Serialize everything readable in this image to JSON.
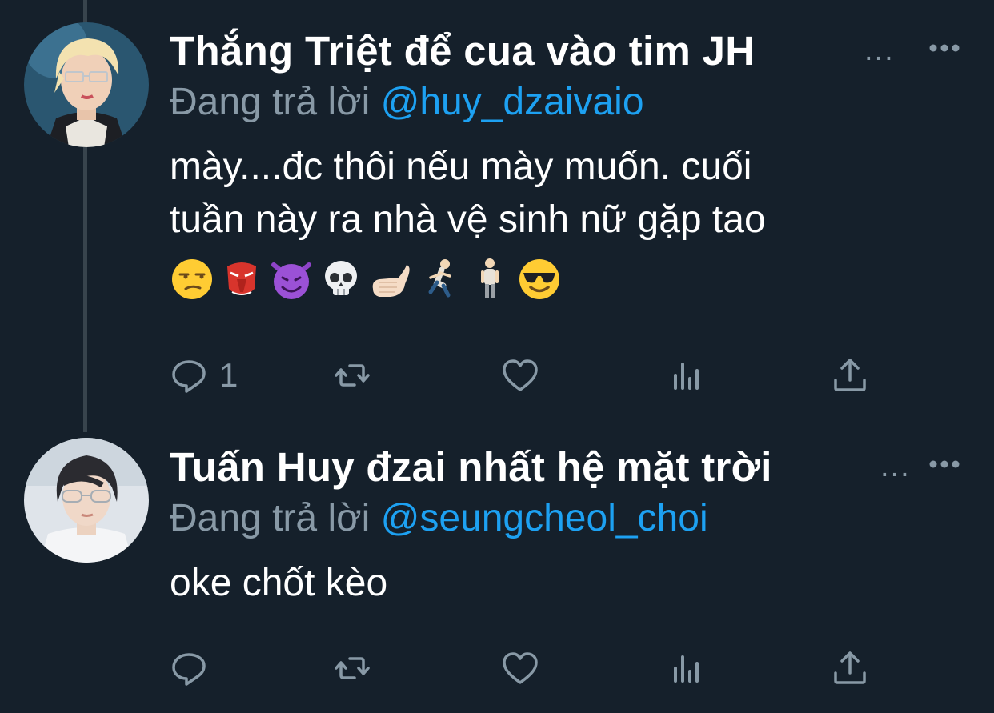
{
  "tweets": [
    {
      "display_name": "Thắng Triệt để cua vào tim JH",
      "name_ellipsis": "...",
      "reply_prefix": "Đang trả lời",
      "reply_to": "@huy_dzaivaio",
      "text": "mày....đc thôi nếu mày muốn. cuối\ntuần này ra nhà vệ sinh nữ gặp tao",
      "emojis": [
        "unamused-face",
        "goblin-mask",
        "smiling-imp",
        "skull",
        "call-me-hand",
        "person-running",
        "person-standing",
        "smiling-face-sunglasses"
      ],
      "reply_count": "1"
    },
    {
      "display_name": "Tuấn Huy đzai nhất hệ mặt trời",
      "name_ellipsis": "...",
      "reply_prefix": "Đang trả lời",
      "reply_to": "@seungcheol_choi",
      "text": "oke chốt kèo",
      "reply_count": ""
    }
  ],
  "icons": {
    "reply": "speech-bubble-icon",
    "retweet": "retweet-icon",
    "like": "heart-icon",
    "stats": "bar-chart-icon",
    "share": "share-icon",
    "more": "more-dots-icon"
  },
  "colors": {
    "background": "#15202b",
    "text_primary": "#ffffff",
    "text_secondary": "#8899a6",
    "mention": "#1da1f2",
    "thread_line": "#38444d"
  }
}
